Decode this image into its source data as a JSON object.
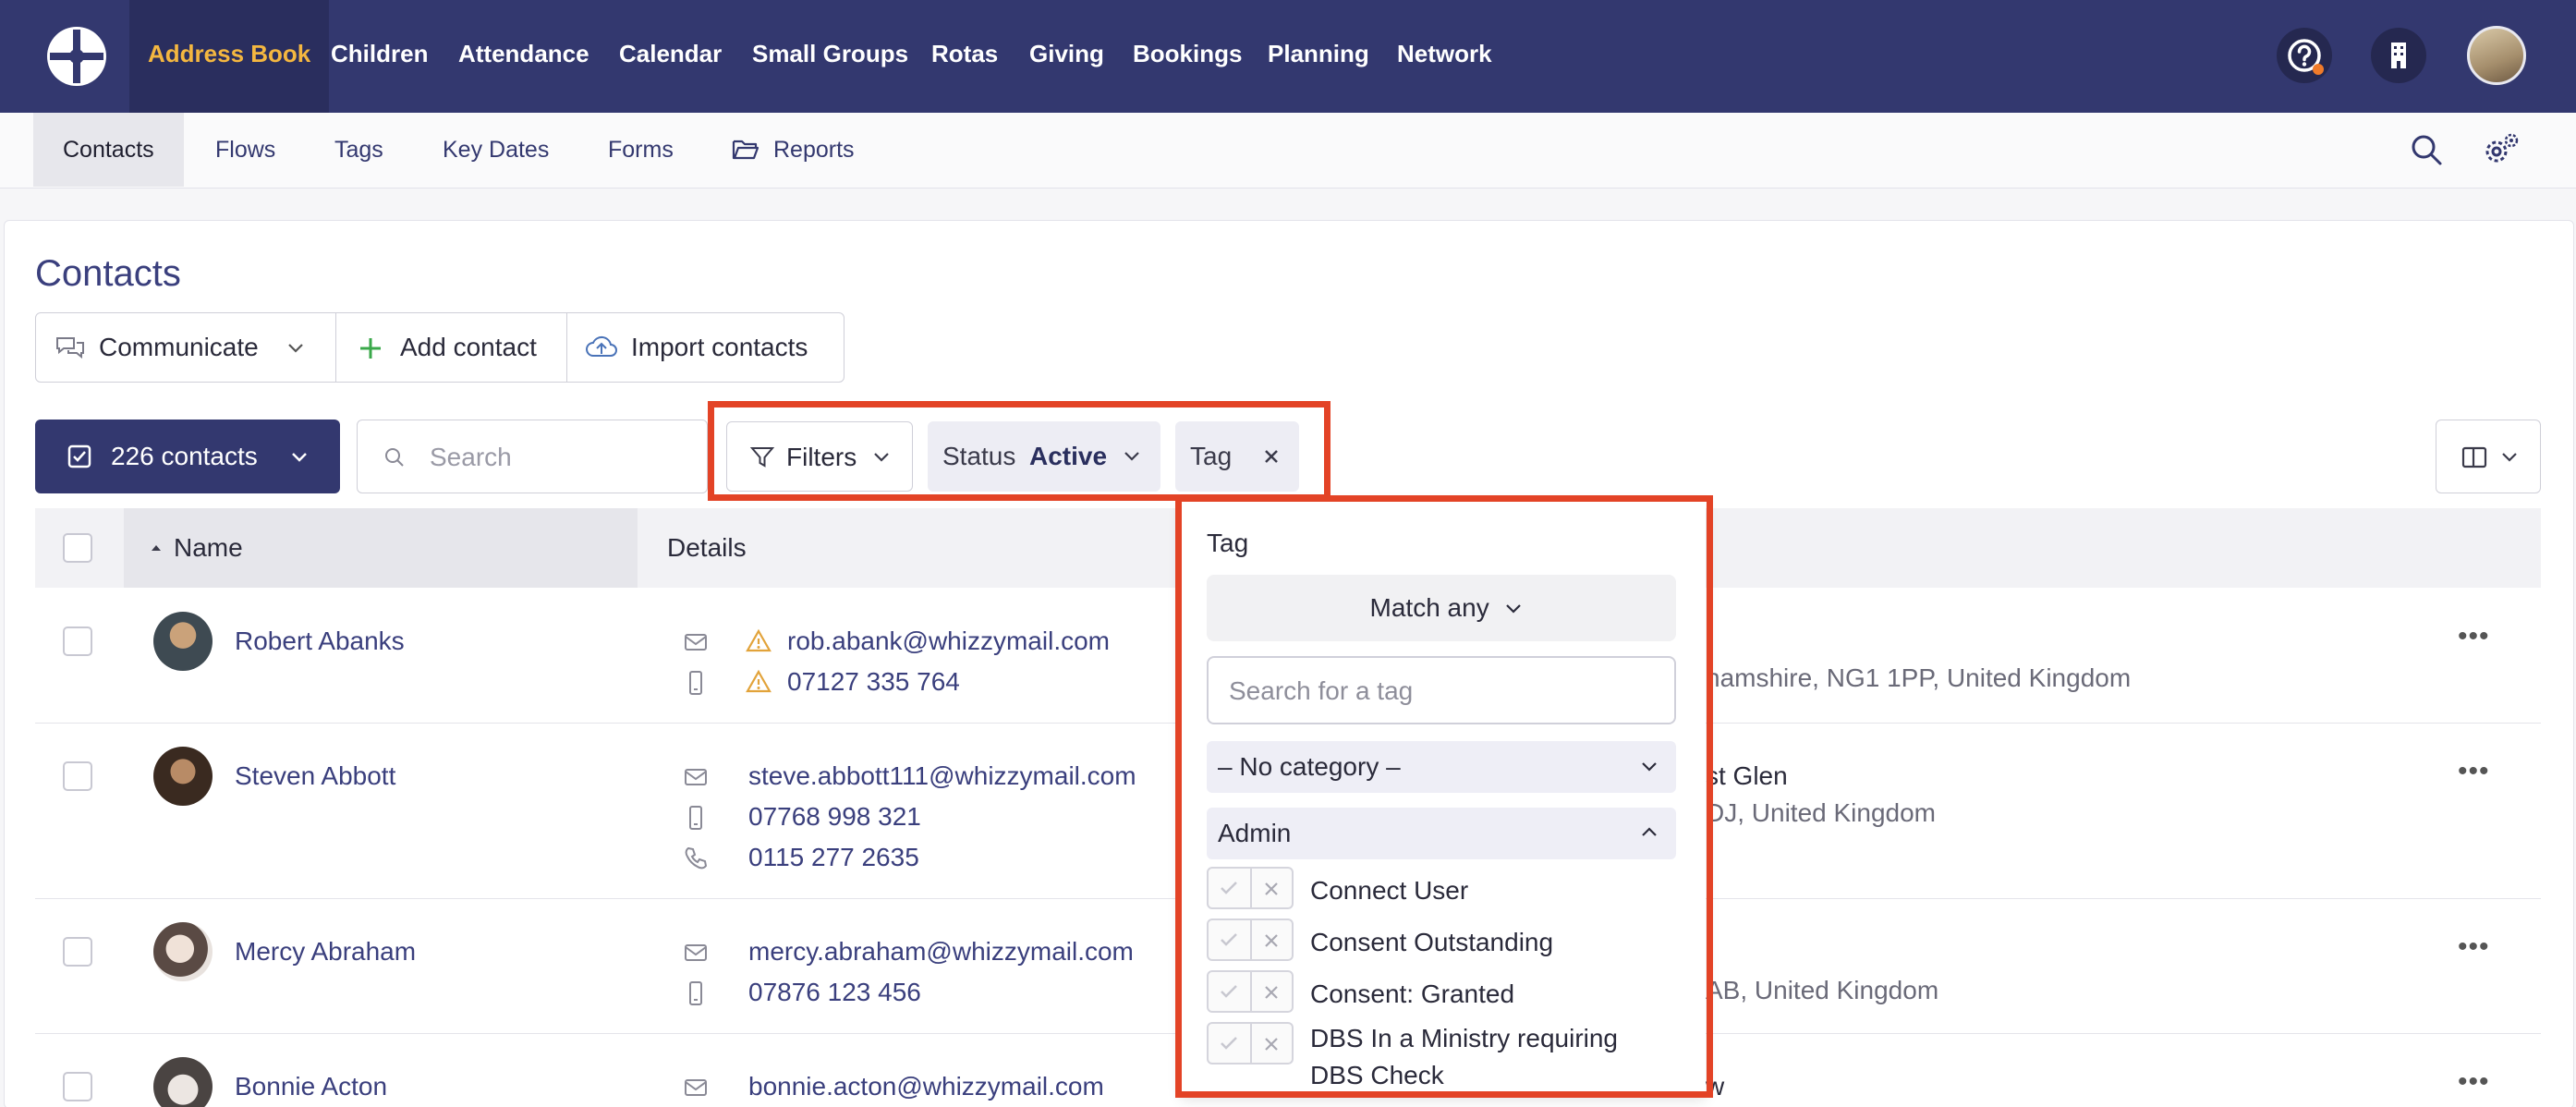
{
  "nav": {
    "items": [
      {
        "label": "Address Book",
        "active": true
      },
      {
        "label": "Children"
      },
      {
        "label": "Attendance"
      },
      {
        "label": "Calendar"
      },
      {
        "label": "Small Groups"
      },
      {
        "label": "Rotas"
      },
      {
        "label": "Giving"
      },
      {
        "label": "Bookings"
      },
      {
        "label": "Planning"
      },
      {
        "label": "Network"
      }
    ],
    "icons": [
      "help-icon",
      "building-icon",
      "user-avatar"
    ],
    "accent": "#f4b740",
    "background": "#33386f"
  },
  "subnav": {
    "items": [
      {
        "label": "Contacts",
        "active": true
      },
      {
        "label": "Flows"
      },
      {
        "label": "Tags"
      },
      {
        "label": "Key Dates"
      },
      {
        "label": "Forms"
      },
      {
        "label": "Reports",
        "icon": "folder-open-icon"
      }
    ]
  },
  "page": {
    "title": "Contacts",
    "actions": {
      "communicate": "Communicate",
      "add_contact": "Add contact",
      "import_contacts": "Import contacts"
    },
    "count_label": "226 contacts",
    "search_placeholder": "Search",
    "filters_label": "Filters",
    "status_chip": {
      "label": "Status",
      "value": "Active"
    },
    "tag_chip": {
      "label": "Tag"
    }
  },
  "table": {
    "headers": {
      "name": "Name",
      "details": "Details"
    },
    "rows": [
      {
        "name": "Robert Abanks",
        "email": "rob.abank@whizzymail.com",
        "mobile": "07127 335 764",
        "address_fragment": "hamshire, NG1 1PP, United Kingdom"
      },
      {
        "name": "Steven Abbott",
        "email": "steve.abbott111@whizzymail.com",
        "mobile": "07768 998 321",
        "phone": "0115 277 2635",
        "address_line1": "st Glen",
        "address_line2": "DJ, United Kingdom"
      },
      {
        "name": "Mercy Abraham",
        "email": "mercy.abraham@whizzymail.com",
        "mobile": "07876 123 456",
        "address_fragment": "AB, United Kingdom"
      },
      {
        "name": "Bonnie Acton",
        "email": "bonnie.acton@whizzymail.com",
        "address_fragment": "w"
      }
    ]
  },
  "tag_dropdown": {
    "title": "Tag",
    "match": "Match any",
    "search_placeholder": "Search for a tag",
    "categories": [
      {
        "label": "– No category –",
        "expanded": false
      },
      {
        "label": "Admin",
        "expanded": true
      }
    ],
    "options": [
      {
        "label": "Connect User"
      },
      {
        "label": "Consent Outstanding"
      },
      {
        "label": "Consent: Granted"
      },
      {
        "label": "DBS In a Ministry requiring DBS Check"
      }
    ]
  },
  "highlight_color": "#e34326"
}
